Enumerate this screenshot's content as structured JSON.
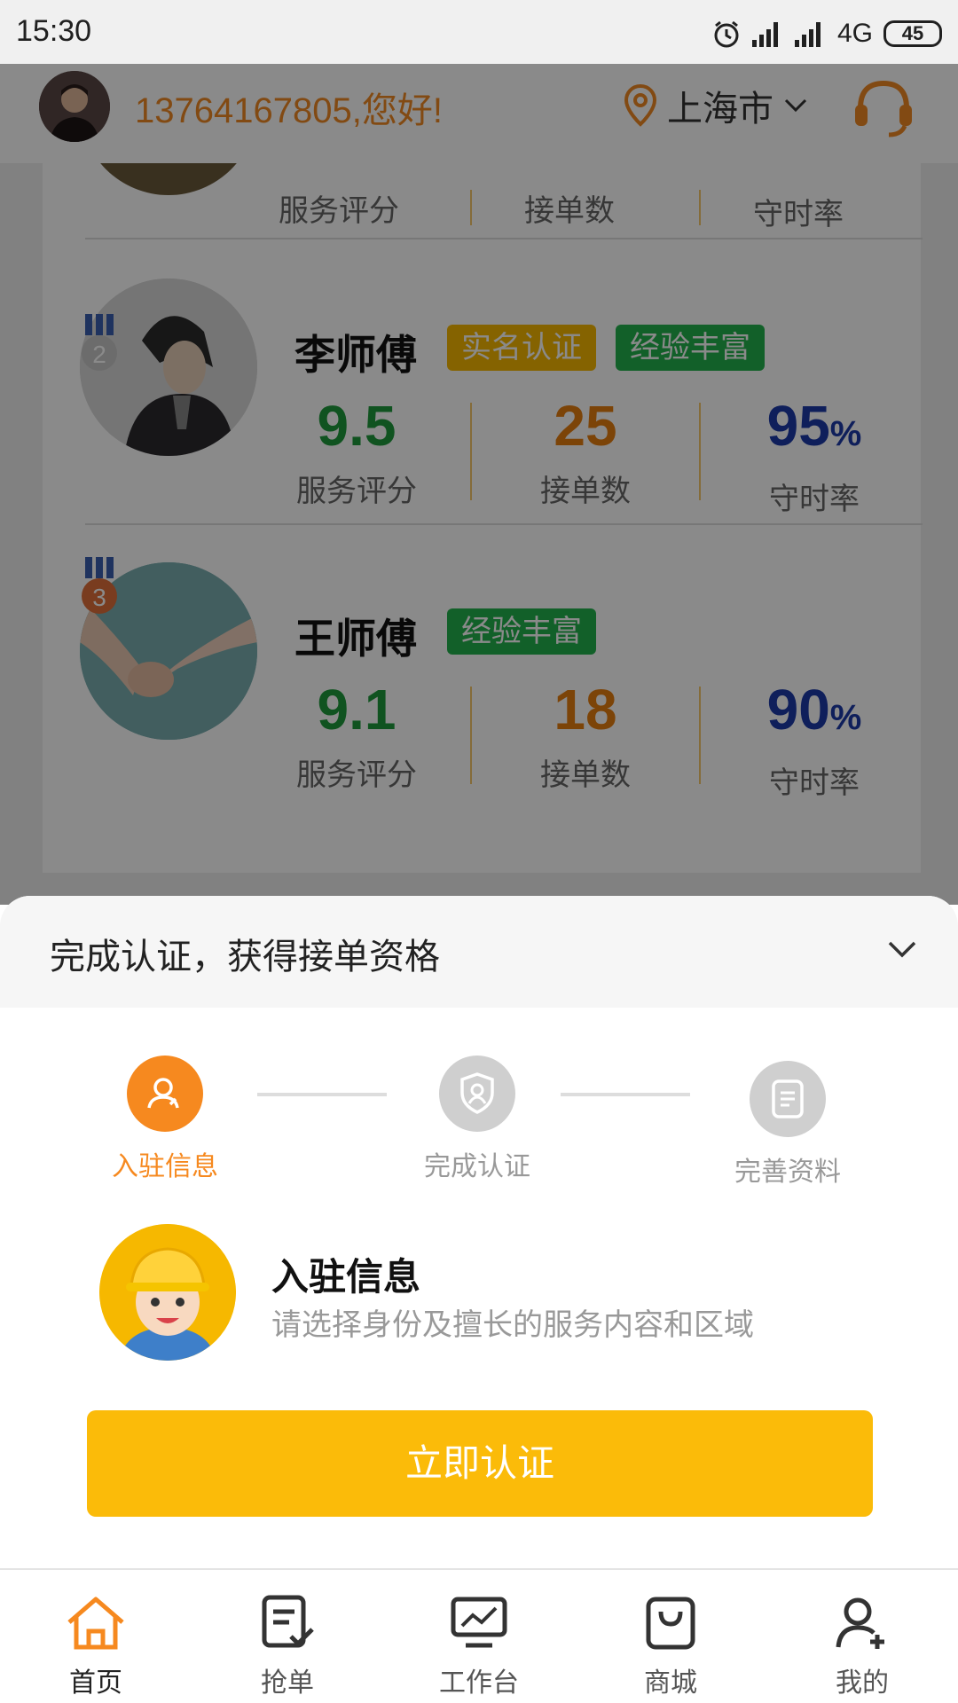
{
  "status_bar": {
    "time": "15:30",
    "network": "4G",
    "battery": "45"
  },
  "header": {
    "greeting": "13764167805,您好!",
    "city": "上海市",
    "accent_color": "#f08a24"
  },
  "stat_labels": {
    "score": "服务评分",
    "orders": "接单数",
    "punctuality": "守时率"
  },
  "ranking": [
    {
      "rank": "2",
      "name": "李师傅",
      "tags": [
        "实名认证",
        "经验丰富"
      ],
      "score": "9.5",
      "orders": "25",
      "punctuality": "95",
      "unit": "%"
    },
    {
      "rank": "3",
      "name": "王师傅",
      "tags": [
        "经验丰富"
      ],
      "score": "9.1",
      "orders": "18",
      "punctuality": "90",
      "unit": "%"
    }
  ],
  "sheet": {
    "title": "完成认证，获得接单资格",
    "steps": [
      {
        "label": "入驻信息",
        "state": "active"
      },
      {
        "label": "完成认证",
        "state": "inactive"
      },
      {
        "label": "完善资料",
        "state": "inactive"
      }
    ],
    "intro_title": "入驻信息",
    "intro_desc": "请选择身份及擅长的服务内容和区域",
    "cta_label": "立即认证",
    "cta_color": "#fbbb09"
  },
  "tab_bar": [
    {
      "label": "首页",
      "icon": "home-icon",
      "active": true
    },
    {
      "label": "抢单",
      "icon": "grab-order-icon",
      "active": false
    },
    {
      "label": "工作台",
      "icon": "workbench-icon",
      "active": false
    },
    {
      "label": "商城",
      "icon": "shop-bag-icon",
      "active": false
    },
    {
      "label": "我的",
      "icon": "profile-add-icon",
      "active": false
    }
  ]
}
